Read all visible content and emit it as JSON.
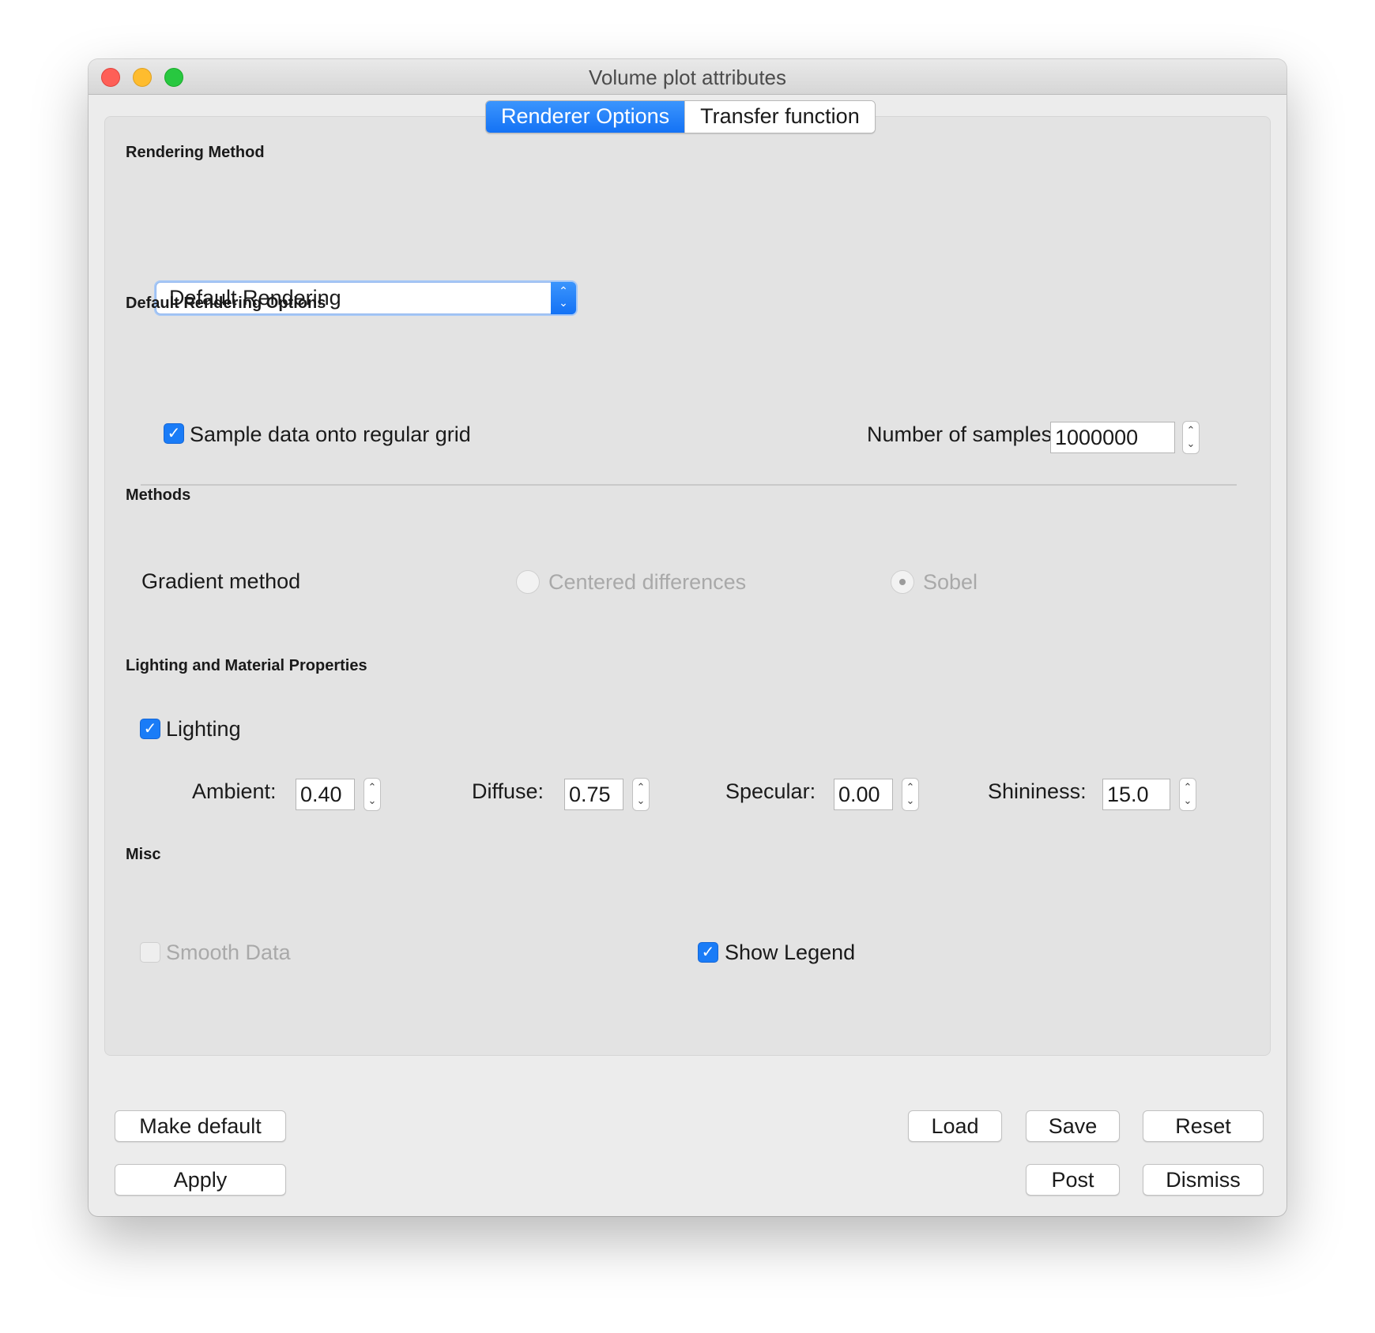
{
  "window": {
    "title": "Volume plot attributes"
  },
  "tabs": [
    {
      "label": "Renderer Options",
      "active": true
    },
    {
      "label": "Transfer function",
      "active": false
    }
  ],
  "rendering_method": {
    "group_label": "Rendering Method",
    "selected": "Default Rendering"
  },
  "default_options": {
    "group_label": "Default Rendering Options",
    "sample_grid_label": "Sample data onto regular grid",
    "sample_grid_checked": true,
    "num_samples_label": "Number of samples",
    "num_samples_value": "1000000"
  },
  "methods": {
    "group_label": "Methods",
    "gradient_label": "Gradient method",
    "options": [
      {
        "label": "Centered differences",
        "selected": false
      },
      {
        "label": "Sobel",
        "selected": true
      }
    ]
  },
  "lighting": {
    "group_label": "Lighting and Material Properties",
    "lighting_label": "Lighting",
    "lighting_checked": true,
    "ambient_label": "Ambient:",
    "ambient_value": "0.40",
    "diffuse_label": "Diffuse:",
    "diffuse_value": "0.75",
    "specular_label": "Specular:",
    "specular_value": "0.00",
    "shininess_label": "Shininess:",
    "shininess_value": "15.0"
  },
  "misc": {
    "group_label": "Misc",
    "smooth_label": "Smooth Data",
    "smooth_checked": false,
    "legend_label": "Show Legend",
    "legend_checked": true
  },
  "buttons": {
    "make_default": "Make default",
    "apply": "Apply",
    "load": "Load",
    "save": "Save",
    "reset": "Reset",
    "post": "Post",
    "dismiss": "Dismiss"
  },
  "colors": {
    "accent": "#1a7cf7",
    "window_bg": "#ececec",
    "panel_bg": "#e3e3e3",
    "disabled_text": "#a9a9a9"
  }
}
